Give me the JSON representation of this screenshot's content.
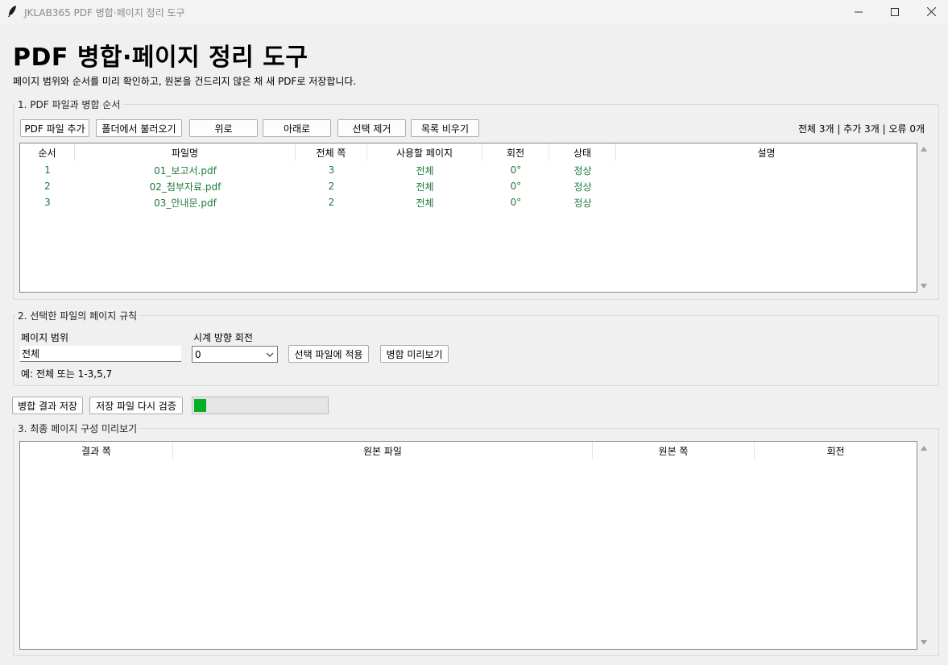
{
  "window": {
    "title": "JKLAB365 PDF 병합·페이지 정리 도구"
  },
  "header": {
    "title": "PDF 병합·페이지 정리 도구",
    "subtitle": "페이지 범위와 순서를 미리 확인하고, 원본을 건드리지 않은 채 새 PDF로 저장합니다."
  },
  "section1": {
    "label": "1. PDF 파일과 병합 순서",
    "buttons": {
      "add_files": "PDF 파일 추가",
      "load_folder": "폴더에서 불러오기",
      "move_up": "위로",
      "move_down": "아래로",
      "remove_selected": "선택 제거",
      "clear_list": "목록 비우기"
    },
    "status": "전체 3개 | 추가 3개 | 오류 0개",
    "columns": [
      "순서",
      "파일명",
      "전체 쪽",
      "사용할 페이지",
      "회전",
      "상태",
      "설명"
    ],
    "rows": [
      {
        "order": "1",
        "filename": "01_보고서.pdf",
        "total_pages": "3",
        "use_pages": "전체",
        "rotation": "0°",
        "state": "정상",
        "note": ""
      },
      {
        "order": "2",
        "filename": "02_첨부자료.pdf",
        "total_pages": "2",
        "use_pages": "전체",
        "rotation": "0°",
        "state": "정상",
        "note": ""
      },
      {
        "order": "3",
        "filename": "03_안내문.pdf",
        "total_pages": "2",
        "use_pages": "전체",
        "rotation": "0°",
        "state": "정상",
        "note": ""
      }
    ],
    "row_text_color": "#1d7a3a"
  },
  "section2": {
    "label": "2. 선택한 파일의 페이지 규칙",
    "page_range_label": "페이지 범위",
    "page_range_value": "전체",
    "rotation_label": "시계 방향 회전",
    "rotation_value": "0",
    "apply_button": "선택 파일에 적용",
    "preview_button": "병합 미리보기",
    "example": "예: 전체 또는 1-3,5,7"
  },
  "actions": {
    "save_button": "병합 결과 저장",
    "verify_button": "저장 파일 다시 검증",
    "progress": 0.09,
    "progress_color": "#06b025"
  },
  "section3": {
    "label": "3. 최종 페이지 구성 미리보기",
    "columns": [
      "결과 쪽",
      "원본 파일",
      "원본 쪽",
      "회전"
    ]
  }
}
